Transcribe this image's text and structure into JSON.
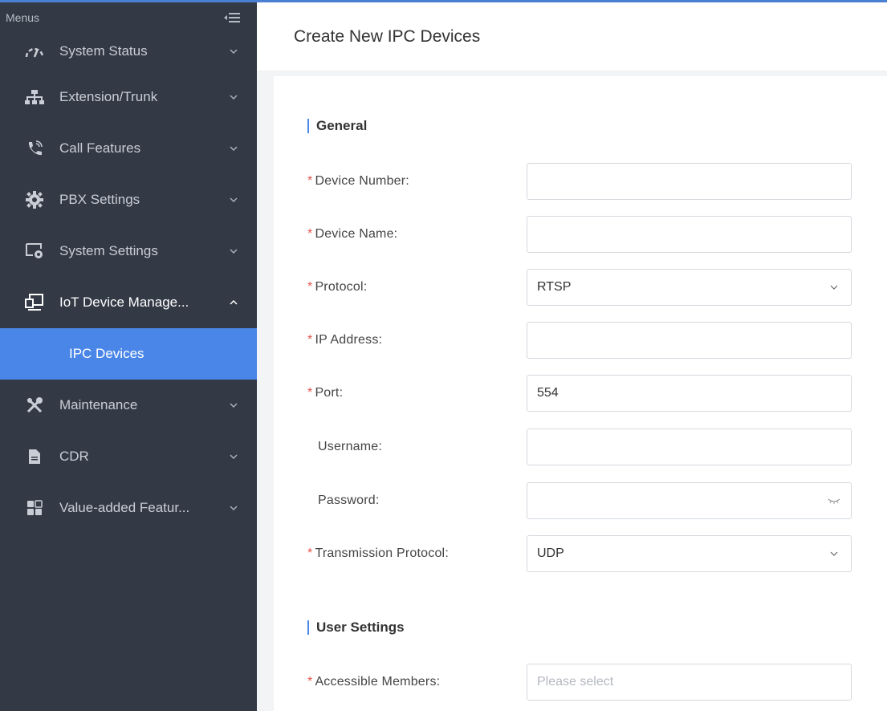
{
  "sidebar": {
    "header": "Menus",
    "items": [
      {
        "label": "System Status",
        "icon": "gauge-icon"
      },
      {
        "label": "Extension/Trunk",
        "icon": "network-icon"
      },
      {
        "label": "Call Features",
        "icon": "phone-icon"
      },
      {
        "label": "PBX Settings",
        "icon": "gear-icon"
      },
      {
        "label": "System Settings",
        "icon": "settings-screen-icon"
      },
      {
        "label": "IoT Device Manage...",
        "icon": "devices-icon",
        "expanded": true
      },
      {
        "label": "Maintenance",
        "icon": "tools-icon"
      },
      {
        "label": "CDR",
        "icon": "document-icon"
      },
      {
        "label": "Value-added Featur...",
        "icon": "grid-icon"
      }
    ],
    "sub_item": "IPC Devices"
  },
  "page": {
    "title": "Create New IPC Devices"
  },
  "sections": {
    "general": "General",
    "user_settings": "User Settings"
  },
  "form": {
    "device_number": {
      "label": "Device Number:",
      "value": ""
    },
    "device_name": {
      "label": "Device Name:",
      "value": ""
    },
    "protocol": {
      "label": "Protocol:",
      "value": "RTSP"
    },
    "ip_address": {
      "label": "IP Address:",
      "value": ""
    },
    "port": {
      "label": "Port:",
      "value": "554"
    },
    "username": {
      "label": "Username:",
      "value": ""
    },
    "password": {
      "label": "Password:",
      "value": ""
    },
    "transmission_protocol": {
      "label": "Transmission Protocol:",
      "value": "UDP"
    },
    "accessible_members": {
      "label": "Accessible Members:",
      "placeholder": "Please select"
    }
  },
  "colors": {
    "sidebar_bg": "#333a45",
    "accent": "#4a86e8",
    "required": "#e5534b"
  }
}
